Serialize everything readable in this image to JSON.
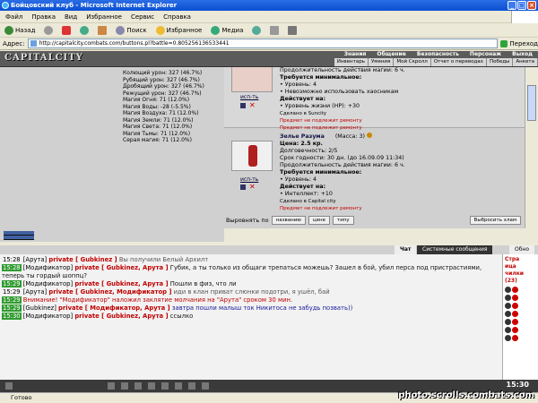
{
  "window": {
    "title": "Бойцовский клуб - Microsoft Internet Explorer"
  },
  "menu": [
    "Файл",
    "Правка",
    "Вид",
    "Избранное",
    "Сервис",
    "Справка"
  ],
  "toolbar": {
    "back": "Назад",
    "search": "Поиск",
    "favorites": "Избранное",
    "media": "Медиа"
  },
  "address": {
    "label": "Адрес:",
    "url": "http://capitalcity.combats.com/buttons.pl?battle=0.805256136533441",
    "go": "Переход"
  },
  "game": {
    "logo": "CAPITALCITY",
    "nav_top": [
      "Знания",
      "Общение",
      "Безопасность",
      "Персонаж",
      "Выход"
    ],
    "nav_sub": [
      "Инвентарь",
      "Умения",
      "Мой Скролл",
      "Отчет о переводах",
      "Победы",
      "Анкета"
    ]
  },
  "stats": [
    "Колющий урон: 327 (46.7%)",
    "Рубящий урон: 327 (46.7%)",
    "Дробящий урон: 327 (46.7%)",
    "Режущий урон: 327 (46.7%)",
    "Магия Огня: 71 (12.0%)",
    "Магия Воды: -28 (-5.5%)",
    "Магия Воздуха: 71 (12.0%)",
    "Магия Земли: 71 (12.0%)",
    "Магия Света: 71 (12.0%)",
    "Магия Тьмы: 71 (12.0%)",
    "Серая магия: 71 (12.0%)"
  ],
  "item1": {
    "use": "исп-ть",
    "lines": [
      "Продолжительность действия магии: 6 ч.",
      "Требуется минимальное:",
      "• Уровень: 4",
      "• Невозможно использовать хаосникам",
      "Действует на:",
      "• Уровень жизни (HP): +30",
      "Сделано в Suncity"
    ],
    "red1": "Предмет не подлежит ремонту",
    "red2": "Предмет не подлежит ремонту"
  },
  "item2": {
    "name": "Зелье Разума",
    "mass": "(Масса: 3)",
    "use": "исп-ть",
    "price": "Цена: 2.5 кр.",
    "lines": [
      "Долговечность: 2/5",
      "Срок годности: 30 дн. (до 16.09.09 11:34)",
      "Продолжительность действия магии: 6 ч.",
      "Требуется минимальное:",
      "• Уровень: 4",
      "Действует на:",
      "• Интеллект: +10",
      "Сделано в Capital city"
    ],
    "red1": "Предмет не подлежит ремонту"
  },
  "align": {
    "label": "Выровнять по",
    "b1": "названию",
    "b2": "цене",
    "b3": "типу",
    "throw": "Выбросить хлам"
  },
  "chat_tabs": {
    "chat": "Чат",
    "system": "Системные сообщения",
    "who": "Обно"
  },
  "chat": [
    {
      "ts": "15:28",
      "green": false,
      "nick": "[Арута]",
      "priv": "private [ Gubkinez ]",
      "msg": "Вы получили Белый Архилт",
      "cls": "msg-gray"
    },
    {
      "ts": "15:28",
      "green": true,
      "nick": "[Модификатор]",
      "priv": "private [ Gubkinez, Арута ]",
      "msg": "Губик, а ты только из общаги трепаться можешь? Зашел в бой, убил перса под пристрастиями, теперь ты гордый шоппц?",
      "cls": "msg-black",
      "wrap": true
    },
    {
      "ts": "15:29",
      "green": true,
      "nick": "[Модификатор]",
      "priv": "private [ Gubkinez, Арута ]",
      "msg": "Пошли в физ, что ли",
      "cls": "msg-black"
    },
    {
      "ts": "15:29",
      "green": false,
      "nick": "[Арута]",
      "priv": "private [ Gubkinez, Модификатор ]",
      "msg": "иди в клан приват слюнки подотри, я ушёл, бай",
      "cls": "msg-gray"
    },
    {
      "ts": "15:29",
      "green": true,
      "nick": "",
      "priv": "",
      "msg": "Внимание! \"Модификатор\" наложил заклятие молчания на \"Арута\" сроком 30 мин.",
      "cls": "msg-red"
    },
    {
      "ts": "15:29",
      "green": true,
      "nick": "[Gubkinez]",
      "priv": "private [ Модификатор, Арута ]",
      "msg": "завтра пошли малыш ток Никитоса не забудь позвать))",
      "cls": "msg-blue"
    },
    {
      "ts": "15:30",
      "green": true,
      "nick": "[Модификатор]",
      "priv": "private [ Gubkinez, Арута ]",
      "msg": "ссылко",
      "cls": "msg-black"
    }
  ],
  "userlist": {
    "header": "Стра",
    "lines": [
      "ица",
      "чилки",
      "(23)"
    ]
  },
  "clock": "15:30",
  "status": "Готово",
  "watermark": "photo.scrolls.combats.com"
}
